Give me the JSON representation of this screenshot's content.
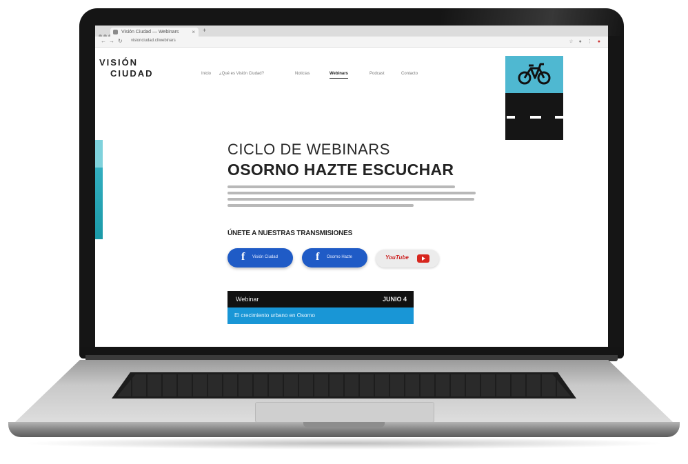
{
  "browser": {
    "tab_title": "Visión Ciudad — Webinars",
    "new_tab_symbol": "+",
    "close_symbol": "×",
    "back_symbol": "←",
    "forward_symbol": "→",
    "reload_symbol": "↻",
    "url": "visionciudad.cl/webinars"
  },
  "site": {
    "logo_line1": "VISIÓN",
    "logo_line2": "CIUDAD",
    "menu": [
      {
        "label": "Inicio"
      },
      {
        "label": "¿Qué es Visión Ciudad?"
      },
      {
        "label": "Noticias"
      },
      {
        "label": "Webinars",
        "active": true
      },
      {
        "label": "Podcast"
      },
      {
        "label": "Contacto"
      }
    ]
  },
  "hero": {
    "heading1": "CICLO DE WEBINARS",
    "heading2": "OSORNO HAZTE ESCUCHAR"
  },
  "social": {
    "join_label": "ÚNETE A NUESTRAS TRANSMISIONES",
    "facebook1_label": "Visión Ciudad",
    "facebook2_label": "Osorno Hazte",
    "youtube_label": "YouTube"
  },
  "table": {
    "head_left": "Webinar",
    "head_right": "JUNIO 4",
    "row1": "El crecimiento urbano en Osorno"
  },
  "colors": {
    "accent_blue": "#1f5bc6",
    "teal": "#4fb8d1",
    "row_blue": "#1996d6"
  }
}
